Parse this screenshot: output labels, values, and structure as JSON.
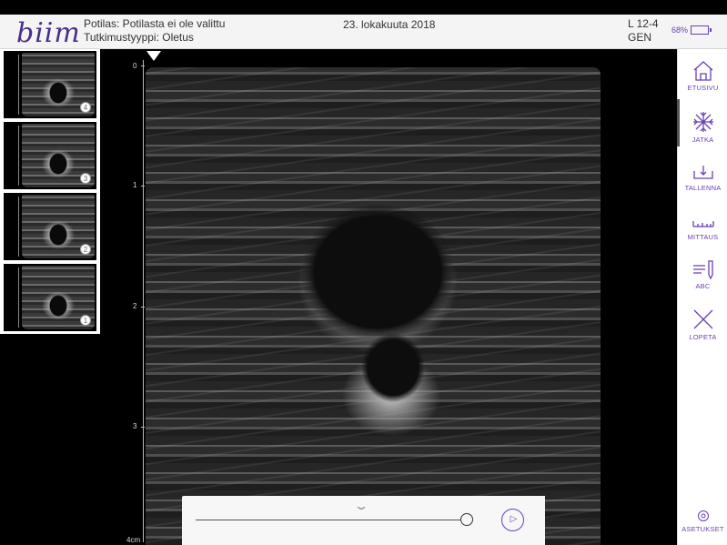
{
  "header": {
    "logo": "biim",
    "patient_line": "Potilas: Potilasta ei ole valittu",
    "exam_line": "Tutkimustyyppi: Oletus",
    "date": "23. lokakuuta 2018",
    "probe_model": "L 12-4",
    "probe_mode": "GEN",
    "battery_percent": "68%",
    "battery_level": 0.68
  },
  "thumbnails": [
    {
      "badge": "4"
    },
    {
      "badge": "3"
    },
    {
      "badge": "2"
    },
    {
      "badge": "1"
    }
  ],
  "depth_scale": {
    "labels": [
      "0",
      "1",
      "2",
      "3",
      "4cm"
    ]
  },
  "sidebar": {
    "items": [
      {
        "label": "ETUSIVU",
        "icon": "home-icon"
      },
      {
        "label": "JATKA",
        "icon": "snowflake-icon"
      },
      {
        "label": "TALLENNA",
        "icon": "save-icon"
      },
      {
        "label": "MITTAUS",
        "icon": "ruler-icon"
      },
      {
        "label": "ABC",
        "icon": "annotate-icon"
      },
      {
        "label": "LOPETA",
        "icon": "close-icon"
      }
    ],
    "settings_label": "ASETUKSET"
  },
  "colors": {
    "accent": "#6a3fb3",
    "header_bg": "#f4f4f4"
  }
}
